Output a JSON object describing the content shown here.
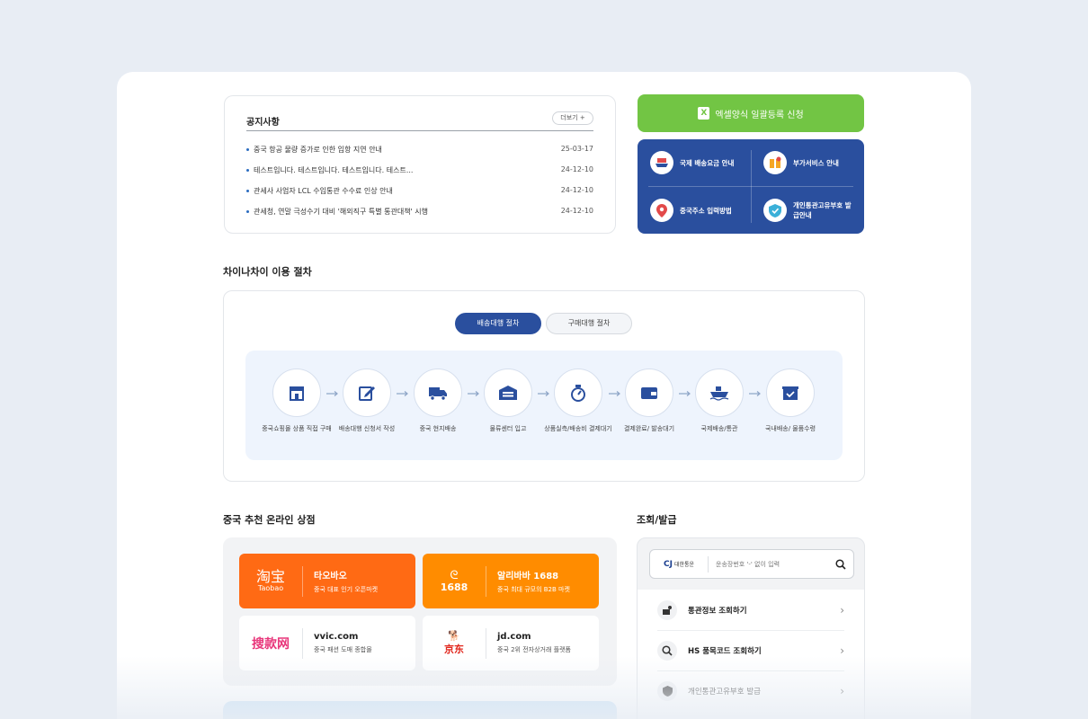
{
  "notice": {
    "title": "공지사항",
    "more_label": "더보기 +",
    "items": [
      {
        "text": "중국 항공 물량 증가로 인한 입항 지연 안내",
        "date": "25-03-17"
      },
      {
        "text": "테스트입니다. 테스트입니다. 테스트입니다. 테스트...",
        "date": "24-12-10"
      },
      {
        "text": "관세사 사업자 LCL 수입통관 수수료 인상 안내",
        "date": "24-12-10"
      },
      {
        "text": "관세청, 연말 극성수기 대비 '해외직구 특별 통관대책' 시행",
        "date": "24-12-10"
      }
    ]
  },
  "excel": {
    "label": "엑셀양식 일괄등록 신청",
    "icon": "excel-icon"
  },
  "quick_links": [
    {
      "label": "국제 배송요금 안내",
      "icon": "ship-icon"
    },
    {
      "label": "부가서비스 안내",
      "icon": "box-icon"
    },
    {
      "label": "중국주소 입력방법",
      "icon": "location-pin-icon"
    },
    {
      "label": "개인통관고유부호 발급안내",
      "icon": "shield-check-icon"
    }
  ],
  "process": {
    "title": "차이나차이 이용 절차",
    "tabs": [
      "배송대행 절차",
      "구매대행 절차"
    ],
    "active_tab": "배송대행 절차",
    "steps": [
      {
        "label": "중국쇼핑몰 상품 직접 구매",
        "icon": "store-icon"
      },
      {
        "label": "배송대행 신청서 작성",
        "icon": "edit-icon"
      },
      {
        "label": "중국 현지배송",
        "icon": "truck-icon"
      },
      {
        "label": "물류센터 입고",
        "icon": "warehouse-icon"
      },
      {
        "label": "상품실측/배송비 결제대기",
        "icon": "scale-icon"
      },
      {
        "label": "결제완료/ 발송대기",
        "icon": "wallet-icon"
      },
      {
        "label": "국제배송/통관",
        "icon": "ship-icon"
      },
      {
        "label": "국내배송/ 물품수령",
        "icon": "package-icon"
      }
    ]
  },
  "shops": {
    "title": "중국 추천 온라인 상점",
    "items": [
      {
        "logo_cn": "淘宝",
        "logo_en": "Taobao",
        "name": "타오바오",
        "desc": "중국 대표 인기 오픈마켓"
      },
      {
        "logo_cn": "1688",
        "name": "알리바바 1688",
        "desc": "중국 최대 규모의 B2B 마켓"
      },
      {
        "logo_cn": "搜款网",
        "name": "vvic.com",
        "desc": "중국 패션 도매 종합몰"
      },
      {
        "logo_cn": "京东",
        "name": "jd.com",
        "desc": "중국 2위 전자상거래 플랫폼"
      }
    ]
  },
  "lookup": {
    "title": "조회/발급",
    "carrier": {
      "brand": "CJ",
      "name": "대한통운"
    },
    "search_placeholder": "운송장번호 '-' 없이 입력",
    "items": [
      {
        "label": "통관정보 조회하기",
        "icon": "customs-icon"
      },
      {
        "label": "HS 품목코드 조회하기",
        "icon": "hs-code-icon"
      },
      {
        "label": "개인통관고유부호 발급",
        "icon": "shield-icon"
      }
    ]
  }
}
